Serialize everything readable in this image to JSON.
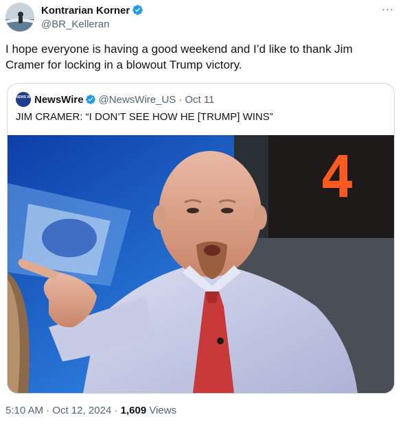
{
  "author": {
    "name": "Kontrarian Korner",
    "handle": "@BR_Kelleran"
  },
  "more_label": "···",
  "tweet_text": "I hope everyone is having a good weekend and I’d like to thank Jim Cramer for locking in a blowout Trump victory.",
  "quote": {
    "avatar_text": "NEWS WIRE",
    "name": "NewsWire",
    "handle": "@NewsWire_US",
    "separator": "·",
    "date": "Oct 11",
    "text": "JIM CRAMER: “I DON’T SEE HOW HE [TRUMP] WINS”",
    "photo_digit": "4"
  },
  "footer": {
    "time": "5:10 AM",
    "sep1": "·",
    "date": "Oct 12, 2024",
    "sep2": "·",
    "views_count": "1,609",
    "views_label": "Views"
  },
  "colors": {
    "verified_blue": "#1d9bf0",
    "text_primary": "#0f1419",
    "text_secondary": "#536471",
    "border": "#cfd9de"
  }
}
